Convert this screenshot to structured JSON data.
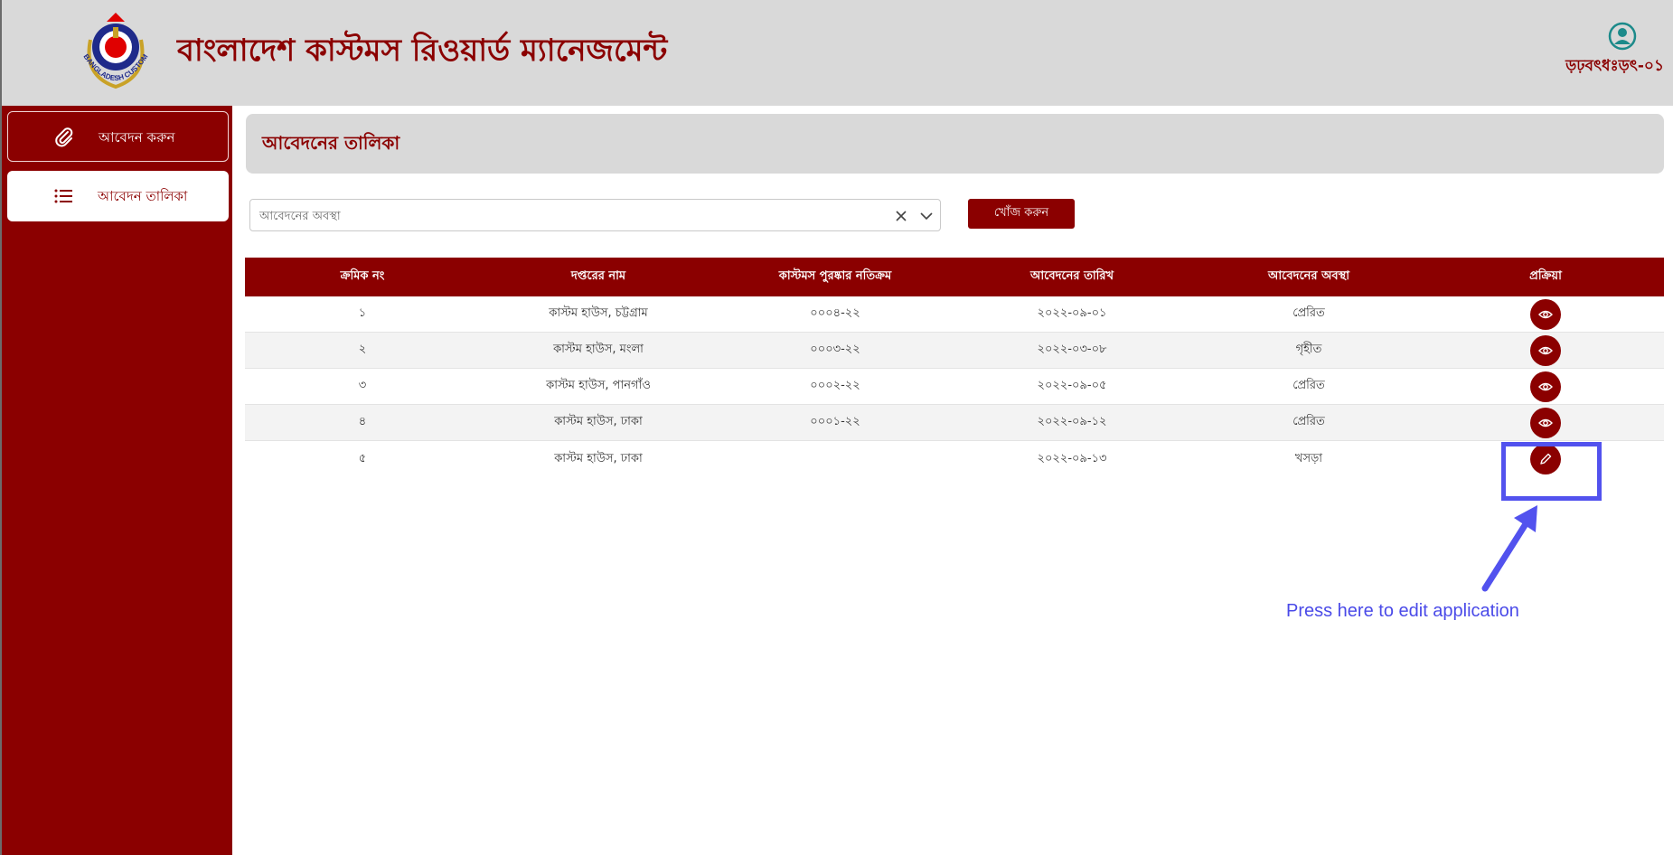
{
  "header": {
    "app_title": "বাংলাদেশ কাস্টমস রিওয়ার্ড ম্যানেজমেন্ট",
    "logo_text": "BANGLADESH CUSTOMS & VAT",
    "user_name": "ড়ঢ়বৎধঃড়ৎ-০১",
    "user_icon": "user-avatar-icon"
  },
  "sidebar": {
    "items": [
      {
        "label": "আবেদন করুন",
        "icon": "paperclip-icon"
      },
      {
        "label": "আবেদন তালিকা",
        "icon": "list-icon"
      }
    ]
  },
  "main": {
    "page_title": "আবেদনের তালিকা",
    "filter": {
      "placeholder": "আবেদনের অবস্থা"
    },
    "search_button": "খোঁজ করুন",
    "table": {
      "columns": [
        "ক্রমিক নং",
        "দপ্তরের নাম",
        "কাস্টমস পুরষ্কার নতিক্রম",
        "আবেদনের তারিখ",
        "আবেদনের অবস্থা",
        "প্রক্রিয়া"
      ],
      "rows": [
        {
          "serial": "১",
          "office": "কাস্টম হাউস, চট্টগ্রাম",
          "reward_no": "০০০৪-২২",
          "date": "২০২২-০৯-০১",
          "status": "প্রেরিত",
          "action": "view-icon"
        },
        {
          "serial": "২",
          "office": "কাস্টম হাউস, মংলা",
          "reward_no": "০০০৩-২২",
          "date": "২০২২-০৩-০৮",
          "status": "গৃহীত",
          "action": "view-icon"
        },
        {
          "serial": "৩",
          "office": "কাস্টম হাউস, পানগাঁও",
          "reward_no": "০০০২-২২",
          "date": "২০২২-০৯-০৫",
          "status": "প্রেরিত",
          "action": "view-icon"
        },
        {
          "serial": "৪",
          "office": "কাস্টম হাউস, ঢাকা",
          "reward_no": "০০০১-২২",
          "date": "২০২২-০৯-১২",
          "status": "প্রেরিত",
          "action": "view-icon"
        },
        {
          "serial": "৫",
          "office": "কাস্টম হাউস, ঢাকা",
          "reward_no": "",
          "date": "২০২২-০৯-১৩",
          "status": "খসড়া",
          "action": "edit-icon"
        }
      ]
    }
  },
  "annotation": {
    "text": "Press here to edit application"
  },
  "colors": {
    "brand": "#8b0000",
    "header_bg": "#d9d9d9",
    "annotation": "#5252ee"
  }
}
